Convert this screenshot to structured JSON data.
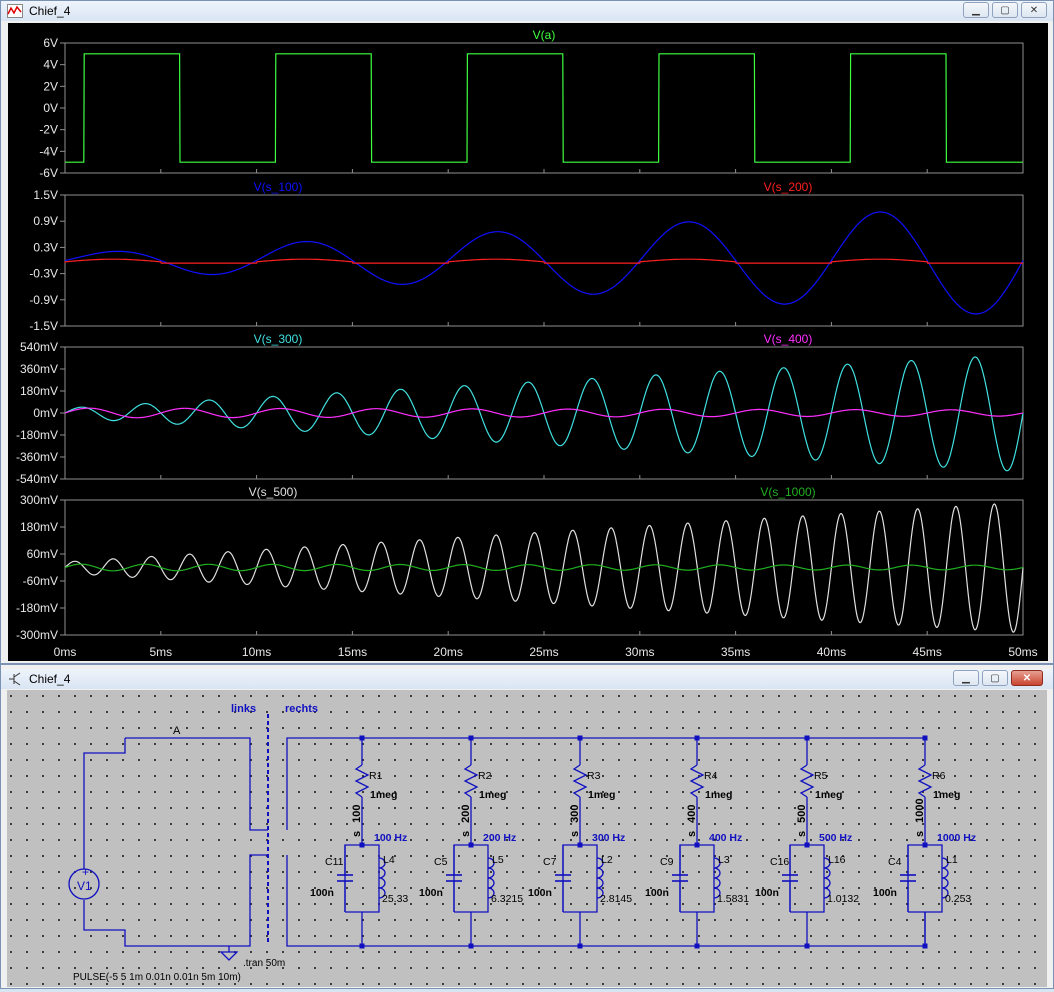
{
  "waveform_window": {
    "title": "Chief_4",
    "controls": {
      "minimize": "▁",
      "maximize": "▢",
      "close": "✕"
    }
  },
  "schematic_window": {
    "title": "Chief_4",
    "controls": {
      "minimize": "▁",
      "maximize": "▢",
      "close": "✕"
    }
  },
  "x_axis": {
    "ticks": [
      "0ms",
      "5ms",
      "10ms",
      "15ms",
      "20ms",
      "25ms",
      "30ms",
      "35ms",
      "40ms",
      "45ms",
      "50ms"
    ],
    "range_ms": [
      0,
      50
    ]
  },
  "chart_data": [
    {
      "type": "line",
      "pane": 1,
      "yticks": [
        "6V",
        "4V",
        "2V",
        "0V",
        "-2V",
        "-4V",
        "-6V"
      ],
      "ylim": [
        -6,
        6
      ],
      "series": [
        {
          "name": "V(a)",
          "color": "#40ff40",
          "kind": "square",
          "low": -5,
          "high": 5,
          "delay_ms": 1,
          "width_ms": 5,
          "period_ms": 10
        }
      ]
    },
    {
      "type": "line",
      "pane": 2,
      "yticks": [
        "1.5V",
        "0.9V",
        "0.3V",
        "-0.3V",
        "-0.9V",
        "-1.5V"
      ],
      "ylim": [
        -1.5,
        1.5
      ],
      "series": [
        {
          "name": "V(s_100)",
          "color": "#1010ff",
          "freq_hz": 100,
          "amp_start": 0.15,
          "amp_end": 1.28,
          "phase": 0
        },
        {
          "name": "V(s_200)",
          "color": "#ff2020",
          "freq_hz": 100,
          "amp_start": 0.06,
          "amp_end": 0.06,
          "phase": 0,
          "kind": "bumps"
        }
      ]
    },
    {
      "type": "line",
      "pane": 3,
      "yticks": [
        "540mV",
        "360mV",
        "180mV",
        "0mV",
        "-180mV",
        "-360mV",
        "-540mV"
      ],
      "ylim": [
        -540,
        540
      ],
      "series": [
        {
          "name": "V(s_300)",
          "color": "#40e0e0",
          "freq_hz": 300,
          "amp_start": 40,
          "amp_end": 480,
          "phase": 0
        },
        {
          "name": "V(s_400)",
          "color": "#ff30ff",
          "freq_hz": 200,
          "amp_start": 40,
          "amp_end": 25,
          "phase": 0
        }
      ]
    },
    {
      "type": "line",
      "pane": 4,
      "yticks": [
        "300mV",
        "180mV",
        "60mV",
        "-60mV",
        "-180mV",
        "-300mV"
      ],
      "ylim": [
        -300,
        300
      ],
      "series": [
        {
          "name": "V(s_500)",
          "color": "#e0e0e0",
          "freq_hz": 500,
          "amp_start": 25,
          "amp_end": 290,
          "phase": 0
        },
        {
          "name": "V(s_1000)",
          "color": "#20b020",
          "freq_hz": 300,
          "amp_start": 15,
          "amp_end": 10,
          "phase": 0
        }
      ]
    }
  ],
  "schematic": {
    "source": {
      "name": "V1",
      "value": "PULSE(-5 5 1m 0.01n 0.01n 5m 10m)"
    },
    "net_a": "A",
    "side_left": "links",
    "side_right": "rechts",
    "tran": ".tran 50m",
    "branches": [
      {
        "r": "R1",
        "rv": "1meg",
        "net": "s_100",
        "net_s": "s",
        "net_n": "100",
        "freq": "100 Hz",
        "c": "C11",
        "cv": "100n",
        "l": "L4",
        "lv": "25.33"
      },
      {
        "r": "R2",
        "rv": "1meg",
        "net": "s_200",
        "net_s": "s",
        "net_n": "200",
        "freq": "200 Hz",
        "c": "C5",
        "cv": "100n",
        "l": "L5",
        "lv": "6.3215"
      },
      {
        "r": "R3",
        "rv": "1meg",
        "net": "s_300",
        "net_s": "s",
        "net_n": "300",
        "freq": "300 Hz",
        "c": "C7",
        "cv": "100n",
        "l": "L2",
        "lv": "2.8145"
      },
      {
        "r": "R4",
        "rv": "1meg",
        "net": "s_400",
        "net_s": "s",
        "net_n": "400",
        "freq": "400 Hz",
        "c": "C9",
        "cv": "100n",
        "l": "L3",
        "lv": "1.5831"
      },
      {
        "r": "R5",
        "rv": "1meg",
        "net": "s_500",
        "net_s": "s",
        "net_n": "500",
        "freq": "500 Hz",
        "c": "C16",
        "cv": "100n",
        "l": "L16",
        "lv": "1.0132"
      },
      {
        "r": "R6",
        "rv": "1meg",
        "net": "s_1000",
        "net_s": "s",
        "net_n": "1000",
        "freq": "1000 Hz",
        "c": "C4",
        "cv": "100n",
        "l": "L1",
        "lv": "0.253"
      }
    ]
  }
}
